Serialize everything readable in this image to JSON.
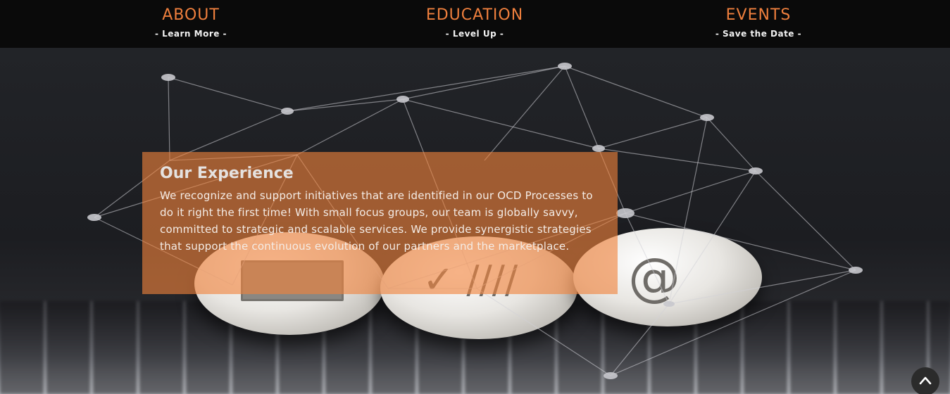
{
  "nav": {
    "items": [
      {
        "title": "ABOUT",
        "subtitle": "- Learn More -"
      },
      {
        "title": "EDUCATION",
        "subtitle": "- Level Up -"
      },
      {
        "title": "EVENTS",
        "subtitle": "- Save the Date -"
      }
    ]
  },
  "hero": {
    "egg_icons": [
      "mail-icon",
      "checklist-icon",
      "at-sign-icon"
    ],
    "at_glyph": "@",
    "check_glyph": "✓ ////"
  },
  "content": {
    "title": "Our Experience",
    "body": "We recognize and support initiatives that are identified in our OCD Processes to do it right the first time! With small focus groups, our team is globally savvy, committed to strategic and scalable services. We provide synergistic strategies that support the continuous evolution of our partners and the marketplace."
  },
  "scroll_top": {
    "icon": "chevron-up-icon"
  },
  "colors": {
    "accent": "#ee7f3d",
    "nav_background": "#0a0a0a",
    "content_box": "#f0823c"
  }
}
